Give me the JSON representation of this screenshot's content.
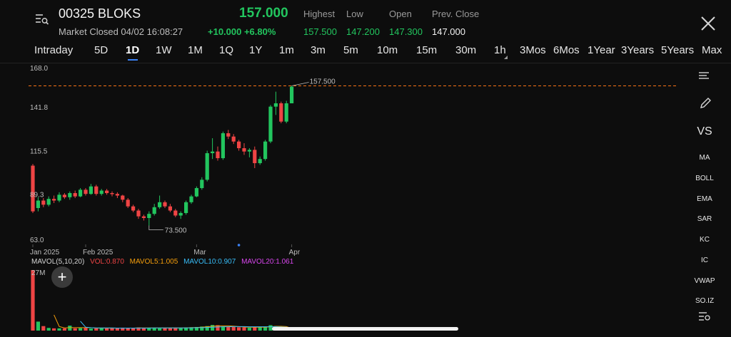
{
  "header": {
    "symbol": "00325 BLOKS",
    "status": "Market Closed 04/02 16:08:27",
    "price": "157.000",
    "change": "+10.000 +6.80%",
    "stats": [
      {
        "label": "Highest",
        "value": "157.500"
      },
      {
        "label": "Low",
        "value": "147.200"
      },
      {
        "label": "Open",
        "value": "147.300"
      },
      {
        "label": "Prev. Close",
        "value": "147.000"
      }
    ]
  },
  "tabs": [
    "Intraday",
    "5D",
    "1D",
    "1W",
    "1M",
    "1Q",
    "1Y",
    "1m",
    "3m",
    "5m",
    "10m",
    "15m",
    "30m",
    "1h",
    "3Mos",
    "6Mos",
    "1Year",
    "3Years",
    "5Years",
    "Max"
  ],
  "active_tab": "1D",
  "toolbar": [
    "MA",
    "BOLL",
    "EMA",
    "SAR",
    "KC",
    "IC",
    "VWAP",
    "SO.IZ"
  ],
  "toolbar_vs": "VS",
  "volume": {
    "title": "MAVOL(5,10,20)",
    "vol": "VOL:0.870",
    "mavol5": "MAVOL5:1.005",
    "mavol10": "MAVOL10:0.907",
    "mavol20": "MAVOL20:1.061",
    "axis_top": "27M",
    "add_label": "+"
  },
  "colors": {
    "up": "#22c55e",
    "down": "#ef4444",
    "ref_line": "#f97316",
    "mavol5": "#f59e0b",
    "mavol10": "#38bdf8",
    "mavol20": "#d946ef",
    "vol": "#ef4444"
  },
  "chart_data": {
    "type": "candlestick",
    "y_ticks": [
      "168.0",
      "141.8",
      "115.5",
      "89.3",
      "63.0"
    ],
    "ylim": [
      63.0,
      168.0
    ],
    "x_ticks": [
      "Jan 2025",
      "Feb 2025",
      "Mar",
      "Apr"
    ],
    "high_annotation": "157.500",
    "low_annotation": "73.500",
    "reference_price": 157.5,
    "candles": [
      {
        "o": 109.5,
        "c": 82.0,
        "h": 110.5,
        "l": 81.0
      },
      {
        "o": 84.0,
        "c": 88.5,
        "h": 90.5,
        "l": 82.0
      },
      {
        "o": 88.5,
        "c": 86.0,
        "h": 90.0,
        "l": 84.5
      },
      {
        "o": 86.0,
        "c": 89.5,
        "h": 91.0,
        "l": 85.0
      },
      {
        "o": 89.5,
        "c": 88.5,
        "h": 91.5,
        "l": 87.0
      },
      {
        "o": 88.5,
        "c": 92.0,
        "h": 93.5,
        "l": 87.5
      },
      {
        "o": 92.0,
        "c": 90.5,
        "h": 93.0,
        "l": 89.5
      },
      {
        "o": 90.5,
        "c": 93.0,
        "h": 94.0,
        "l": 89.0
      },
      {
        "o": 93.0,
        "c": 91.0,
        "h": 94.5,
        "l": 90.0
      },
      {
        "o": 91.0,
        "c": 95.0,
        "h": 96.0,
        "l": 90.5
      },
      {
        "o": 95.0,
        "c": 92.5,
        "h": 96.0,
        "l": 91.5
      },
      {
        "o": 92.5,
        "c": 97.0,
        "h": 98.5,
        "l": 92.0
      },
      {
        "o": 97.0,
        "c": 92.5,
        "h": 98.0,
        "l": 91.5
      },
      {
        "o": 92.5,
        "c": 94.5,
        "h": 95.5,
        "l": 91.5
      },
      {
        "o": 94.5,
        "c": 93.0,
        "h": 95.5,
        "l": 92.0
      },
      {
        "o": 93.0,
        "c": 92.5,
        "h": 94.0,
        "l": 91.0
      },
      {
        "o": 92.5,
        "c": 91.5,
        "h": 93.5,
        "l": 90.0
      },
      {
        "o": 91.5,
        "c": 89.0,
        "h": 92.0,
        "l": 87.5
      },
      {
        "o": 89.0,
        "c": 85.0,
        "h": 90.0,
        "l": 84.0
      },
      {
        "o": 85.0,
        "c": 82.5,
        "h": 86.0,
        "l": 81.5
      },
      {
        "o": 82.5,
        "c": 79.0,
        "h": 83.5,
        "l": 77.5
      },
      {
        "o": 79.0,
        "c": 78.0,
        "h": 80.0,
        "l": 76.5
      },
      {
        "o": 78.0,
        "c": 80.5,
        "h": 82.0,
        "l": 73.5
      },
      {
        "o": 80.5,
        "c": 84.5,
        "h": 86.5,
        "l": 79.5
      },
      {
        "o": 84.5,
        "c": 87.5,
        "h": 91.5,
        "l": 83.5
      },
      {
        "o": 87.5,
        "c": 85.0,
        "h": 88.5,
        "l": 84.0
      },
      {
        "o": 85.0,
        "c": 82.5,
        "h": 86.5,
        "l": 81.5
      },
      {
        "o": 82.5,
        "c": 79.5,
        "h": 83.5,
        "l": 78.5
      },
      {
        "o": 79.5,
        "c": 81.0,
        "h": 82.0,
        "l": 77.5
      },
      {
        "o": 81.0,
        "c": 87.5,
        "h": 88.5,
        "l": 80.0
      },
      {
        "o": 87.5,
        "c": 91.0,
        "h": 92.0,
        "l": 86.5
      },
      {
        "o": 91.0,
        "c": 96.0,
        "h": 97.0,
        "l": 90.5
      },
      {
        "o": 96.0,
        "c": 101.0,
        "h": 102.5,
        "l": 95.0
      },
      {
        "o": 101.0,
        "c": 117.0,
        "h": 118.5,
        "l": 100.0
      },
      {
        "o": 117.0,
        "c": 118.0,
        "h": 126.0,
        "l": 113.5
      },
      {
        "o": 118.0,
        "c": 114.0,
        "h": 121.0,
        "l": 112.5
      },
      {
        "o": 114.0,
        "c": 129.0,
        "h": 130.0,
        "l": 113.0
      },
      {
        "o": 129.0,
        "c": 127.0,
        "h": 131.0,
        "l": 125.5
      },
      {
        "o": 127.0,
        "c": 124.0,
        "h": 128.5,
        "l": 122.5
      },
      {
        "o": 124.0,
        "c": 120.0,
        "h": 125.0,
        "l": 118.5
      },
      {
        "o": 120.0,
        "c": 118.0,
        "h": 123.0,
        "l": 116.0
      },
      {
        "o": 118.0,
        "c": 119.0,
        "h": 120.0,
        "l": 114.5
      },
      {
        "o": 119.0,
        "c": 111.0,
        "h": 121.0,
        "l": 108.0
      },
      {
        "o": 111.0,
        "c": 113.5,
        "h": 115.0,
        "l": 110.0
      },
      {
        "o": 113.5,
        "c": 124.0,
        "h": 125.0,
        "l": 112.5
      },
      {
        "o": 124.0,
        "c": 145.0,
        "h": 146.0,
        "l": 123.0
      },
      {
        "o": 145.0,
        "c": 147.0,
        "h": 154.0,
        "l": 140.0
      },
      {
        "o": 147.0,
        "c": 136.0,
        "h": 148.0,
        "l": 135.0
      },
      {
        "o": 136.0,
        "c": 147.0,
        "h": 148.5,
        "l": 135.0
      },
      {
        "o": 147.0,
        "c": 157.0,
        "h": 157.5,
        "l": 147.0
      }
    ],
    "volume": [
      27,
      4,
      2,
      1.2,
      1,
      1,
      1,
      2.2,
      1,
      1.1,
      1.2,
      0.9,
      1,
      1.2,
      1,
      1.1,
      1,
      1.3,
      1.2,
      1,
      1.4,
      1.2,
      1.3,
      1.1,
      1,
      1.2,
      1.1,
      1.3,
      1.2,
      1.4,
      1.5,
      1.6,
      1.8,
      2,
      2.5,
      2.4,
      1.8,
      1.7,
      1.6,
      1.5,
      1.4,
      1.3,
      1.5,
      1.6,
      1.8,
      2.4,
      2.0,
      1.5,
      1.2,
      0.87
    ],
    "mavol5": [
      null,
      null,
      null,
      null,
      7,
      1.8,
      1.2,
      1.3,
      1.3,
      1.3,
      1.3,
      1.3,
      1.1,
      1.1,
      1.1,
      1.1,
      1.1,
      1.1,
      1.1,
      1.1,
      1.2,
      1.2,
      1.2,
      1.2,
      1.2,
      1.2,
      1.2,
      1.2,
      1.2,
      1.2,
      1.3,
      1.4,
      1.5,
      1.7,
      1.9,
      2.1,
      2.1,
      2.1,
      2.0,
      1.8,
      1.6,
      1.5,
      1.5,
      1.5,
      1.5,
      1.7,
      1.9,
      1.9,
      1.8,
      1.005
    ],
    "mavol10": [
      null,
      null,
      null,
      null,
      null,
      null,
      null,
      null,
      null,
      4.2,
      1.5,
      1.3,
      1.2,
      1.2,
      1.2,
      1.2,
      1.1,
      1.1,
      1.1,
      1.1,
      1.1,
      1.1,
      1.1,
      1.2,
      1.2,
      1.2,
      1.2,
      1.2,
      1.2,
      1.2,
      1.2,
      1.3,
      1.3,
      1.4,
      1.5,
      1.6,
      1.7,
      1.7,
      1.8,
      1.8,
      1.8,
      1.7,
      1.7,
      1.7,
      1.7,
      1.7,
      1.7,
      1.6,
      1.5,
      0.907
    ]
  }
}
